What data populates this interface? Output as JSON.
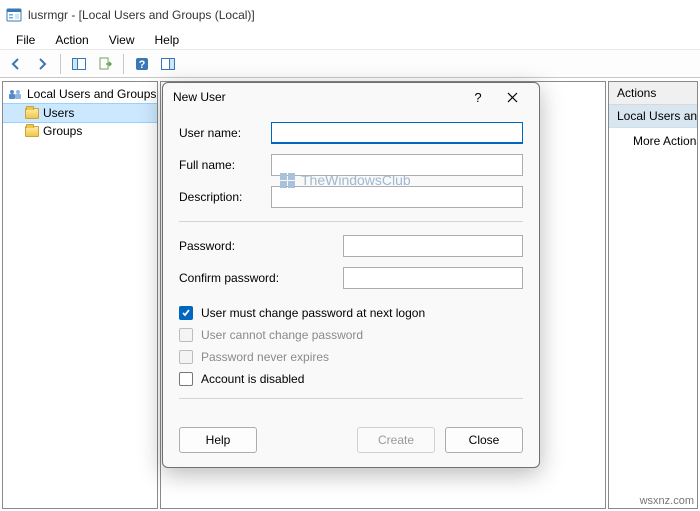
{
  "window": {
    "title": "lusrmgr - [Local Users and Groups (Local)]"
  },
  "menu": {
    "file": "File",
    "action": "Action",
    "view": "View",
    "help": "Help"
  },
  "tree": {
    "root": "Local Users and Groups",
    "items": [
      {
        "label": "Users",
        "selected": true
      },
      {
        "label": "Groups",
        "selected": false
      }
    ]
  },
  "actions": {
    "header": "Actions",
    "category": "Local Users and Groups",
    "more": "More Actions"
  },
  "dialog": {
    "title": "New User",
    "help_symbol": "?",
    "labels": {
      "username": "User name:",
      "fullname": "Full name:",
      "description": "Description:",
      "password": "Password:",
      "confirm": "Confirm password:"
    },
    "values": {
      "username": "",
      "fullname": "",
      "description": "",
      "password": "",
      "confirm": ""
    },
    "checks": {
      "must_change": "User must change password at next logon",
      "cannot_change": "User cannot change password",
      "never_expires": "Password never expires",
      "disabled": "Account is disabled"
    },
    "buttons": {
      "help": "Help",
      "create": "Create",
      "close": "Close"
    }
  },
  "watermark": "TheWindowsClub",
  "corner": "wsxnz.com"
}
